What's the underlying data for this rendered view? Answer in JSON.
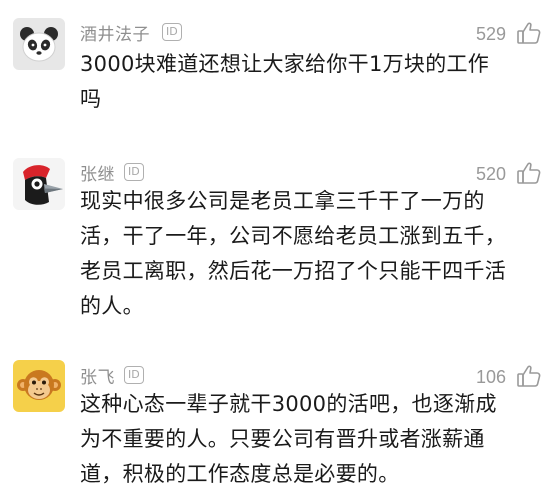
{
  "comments": [
    {
      "author": "酒井法子",
      "badge": "ID",
      "likes": "529",
      "text": "3000块难道还想让大家给你干1万块的工作吗",
      "avatar_icon": "panda-avatar-icon",
      "like_icon": "thumbs-up-icon"
    },
    {
      "author": "张继",
      "badge": "ID",
      "likes": "520",
      "text": "现实中很多公司是老员工拿三千干了一万的活，干了一年，公司不愿给老员工涨到五千，老员工离职，然后花一万招了个只能干四千活的人。",
      "avatar_icon": "woodpecker-avatar-icon",
      "like_icon": "thumbs-up-icon"
    },
    {
      "author": "张飞",
      "badge": "ID",
      "likes": "106",
      "text": "这种心态一辈子就干3000的活吧，也逐渐成为不重要的人。只要公司有晋升或者涨薪通道，积极的工作态度总是必要的。",
      "avatar_icon": "monkey-avatar-icon",
      "like_icon": "thumbs-up-icon"
    }
  ],
  "colors": {
    "meta_gray": "#8f8f8f",
    "text": "#1a1a1a",
    "monkey_bg": "#f5d04a",
    "panda_bg": "#e7e7e7"
  }
}
